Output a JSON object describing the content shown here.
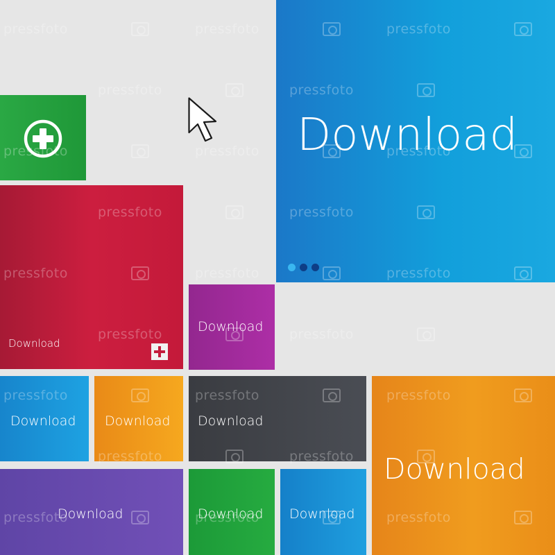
{
  "watermark": {
    "text": "pressfoto"
  },
  "tiles": {
    "blue_large": {
      "label": "Download",
      "color": "#1a90d2"
    },
    "green_plus": {
      "icon": "plus-circle-icon",
      "color": "#28a83f"
    },
    "red": {
      "label": "Download",
      "icon": "plus-square-icon",
      "color": "#c41c3c"
    },
    "magenta": {
      "label": "Download",
      "color": "#a22aa0"
    },
    "blue_small": {
      "label": "Download",
      "color": "#1e95d6"
    },
    "orange_small": {
      "label": "Download",
      "color": "#f09a1b"
    },
    "dark": {
      "label": "Download",
      "color": "#3f4248"
    },
    "orange_large": {
      "label": "Download",
      "color": "#ec911a"
    },
    "purple": {
      "label": "Download",
      "color": "#6c4bb0"
    },
    "green_small": {
      "label": "Download",
      "color": "#21a43c"
    },
    "blue_bottom": {
      "label": "Download",
      "color": "#1a8fd4"
    }
  },
  "page_dots": {
    "colors": [
      "#3ab7f0",
      "#0e3e86",
      "#0e3e86"
    ]
  },
  "cursor": {
    "icon": "arrow-cursor-icon"
  }
}
